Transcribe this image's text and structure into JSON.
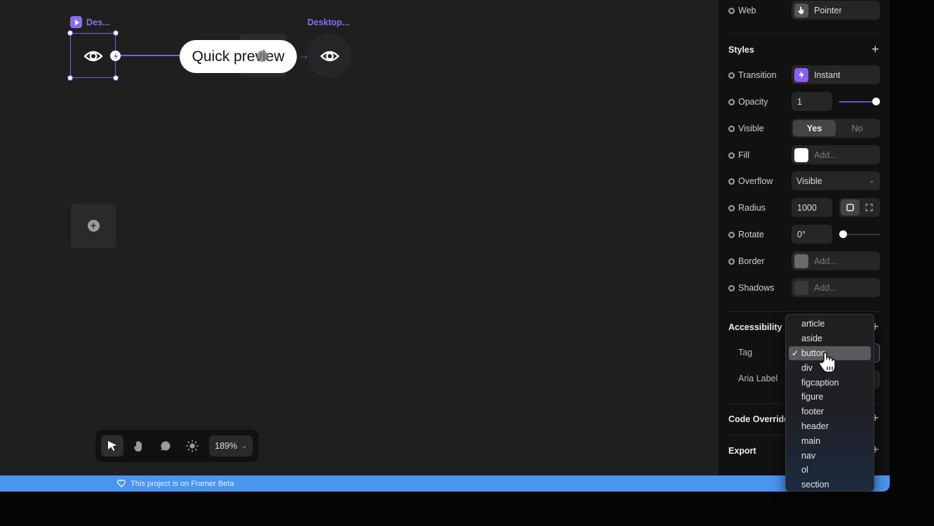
{
  "canvas": {
    "source_frame_label": "Des...",
    "target_frame_label": "Desktop...",
    "preview_button_text": "Quick preview",
    "add_frame_icon": "plus-circle-icon"
  },
  "toolbar": {
    "tools": [
      {
        "name": "select",
        "icon": "pointer-arrow-icon",
        "active": true
      },
      {
        "name": "hand",
        "icon": "hand-icon",
        "active": false
      },
      {
        "name": "comment",
        "icon": "comment-bubble-icon",
        "active": false
      },
      {
        "name": "theme",
        "icon": "sun-icon",
        "active": false
      }
    ],
    "zoom_level": "189%"
  },
  "banner": {
    "text": "This project is on Framer Beta",
    "icon": "heart-icon",
    "color": "#4a95ef"
  },
  "panel": {
    "cursor_row": {
      "label": "Web",
      "value": "Pointer",
      "icon": "pointer-hand-icon"
    },
    "styles": {
      "title": "Styles",
      "add_label": "+",
      "transition": {
        "label": "Transition",
        "value": "Instant",
        "icon": "bolt-icon",
        "accent": "#8b5cf6"
      },
      "opacity": {
        "label": "Opacity",
        "value": "1",
        "slider_fraction": 1.0
      },
      "visible": {
        "label": "Visible",
        "options": [
          "Yes",
          "No"
        ],
        "selected": "Yes"
      },
      "fill": {
        "label": "Fill",
        "placeholder": "Add...",
        "swatch": "#ffffff"
      },
      "overflow": {
        "label": "Overflow",
        "value": "Visible"
      },
      "radius": {
        "label": "Radius",
        "value": "1000",
        "mode": "uniform"
      },
      "rotate": {
        "label": "Rotate",
        "value": "0°",
        "slider_fraction": 0.0
      },
      "border": {
        "label": "Border",
        "placeholder": "Add...",
        "swatch": "#6a6a6a"
      },
      "shadows": {
        "label": "Shadows",
        "placeholder": "Add...",
        "swatch": "#3a3a3a"
      }
    },
    "accessibility": {
      "title": "Accessibility",
      "add_label": "+",
      "tag_label": "Tag",
      "aria_label": "Aria Label"
    },
    "code_overrides": {
      "title": "Code Overrides",
      "add_label": "+"
    },
    "export": {
      "title": "Export",
      "add_label": "+"
    }
  },
  "tag_dropdown": {
    "selected": "button",
    "options": [
      "article",
      "aside",
      "button",
      "div",
      "figcaption",
      "figure",
      "footer",
      "header",
      "main",
      "nav",
      "ol",
      "section"
    ]
  }
}
